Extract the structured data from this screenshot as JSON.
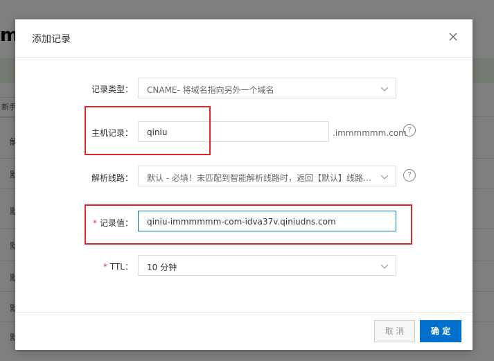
{
  "background": {
    "title_fragment": "m",
    "subtab_fragment": "新手",
    "row_fragments": [
      "解",
      "默",
      "默",
      "默",
      "默",
      "默",
      "默"
    ]
  },
  "dialog": {
    "title": "添加记录",
    "close_icon": "close-icon"
  },
  "form": {
    "record_type": {
      "label": "记录类型：",
      "value": "CNAME- 将域名指向另外一个域名"
    },
    "host": {
      "label": "主机记录：",
      "value": "qiniu",
      "suffix": ".immmmmm.com",
      "help": "?"
    },
    "line": {
      "label": "解析线路：",
      "value": "默认 - 必填！未匹配到智能解析线路时，返回【默认】线路设...",
      "help": "?"
    },
    "record_value": {
      "required": "*",
      "label": "记录值：",
      "value": "qiniu-immmmmm-com-idva37v.qiniudns.com"
    },
    "ttl": {
      "required": "*",
      "label": "TTL：",
      "value": "10 分钟"
    }
  },
  "footer": {
    "cancel_label": "取 消",
    "ok_label": "确 定"
  },
  "colors": {
    "primary": "#0070cc",
    "annotation_red": "#e0242e",
    "required": "#e4393c"
  }
}
